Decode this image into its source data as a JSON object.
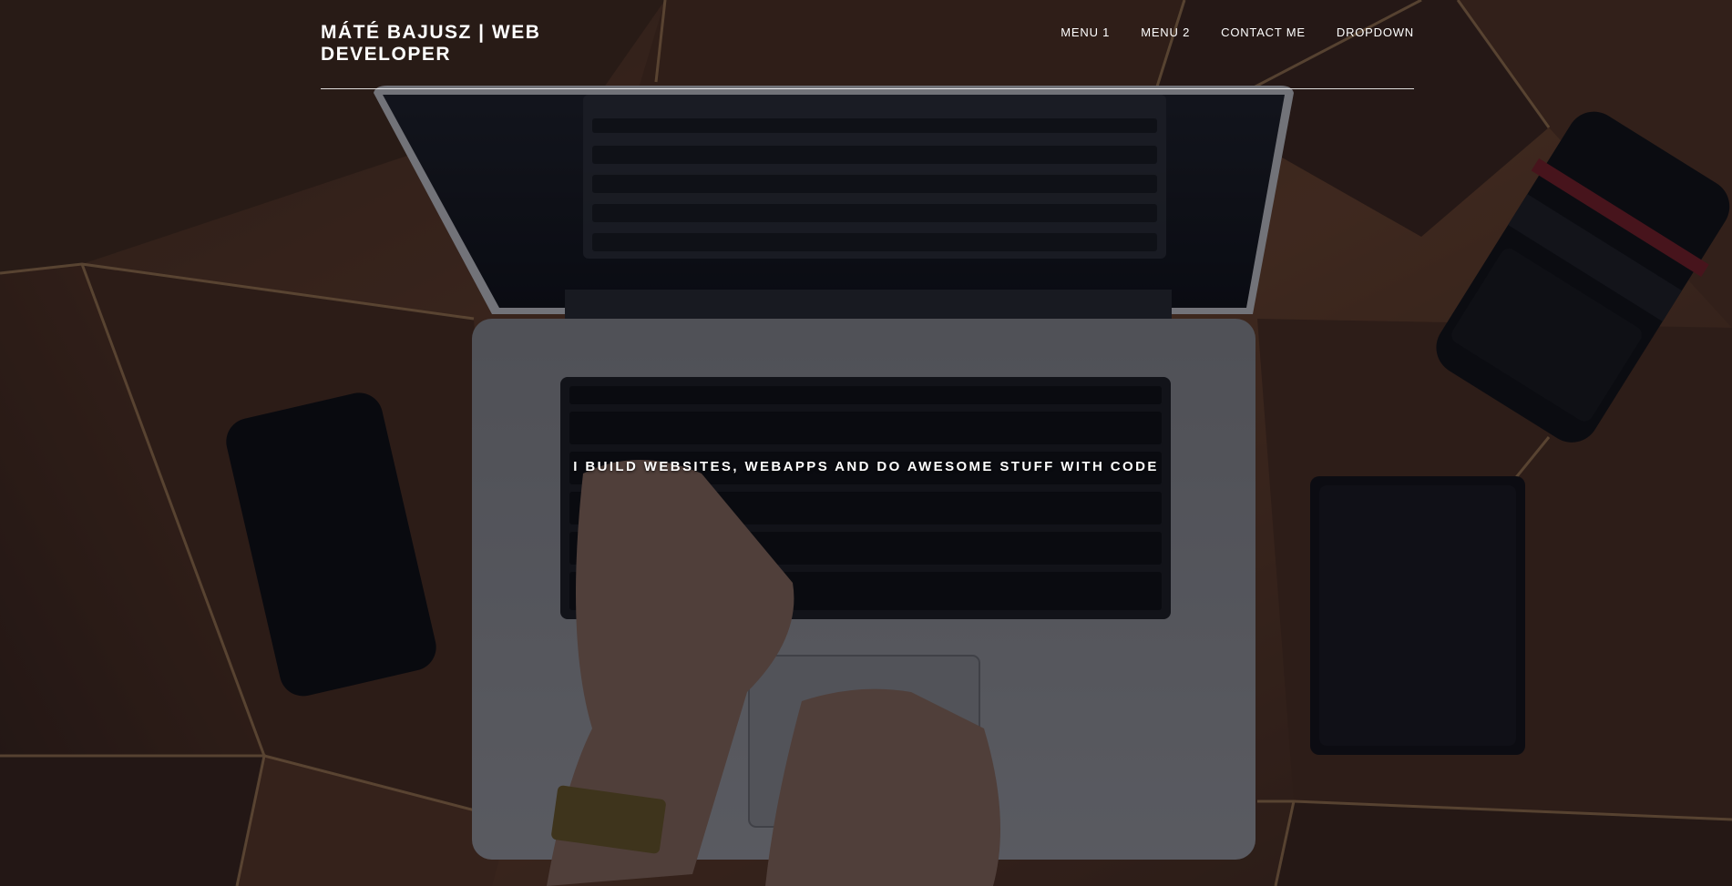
{
  "header": {
    "brand": "MÁTÉ BAJUSZ | WEB DEVELOPER",
    "nav": [
      {
        "label": "MENU 1"
      },
      {
        "label": "MENU 2"
      },
      {
        "label": "CONTACT ME"
      },
      {
        "label": "DROPDOWN"
      }
    ]
  },
  "hero": {
    "tagline": "I BUILD WEBSITES, WEBAPPS AND DO AWESOME STUFF WITH CODE"
  },
  "colors": {
    "text": "#ffffff",
    "wood": "#5a3624",
    "overlay": "#080a14"
  }
}
